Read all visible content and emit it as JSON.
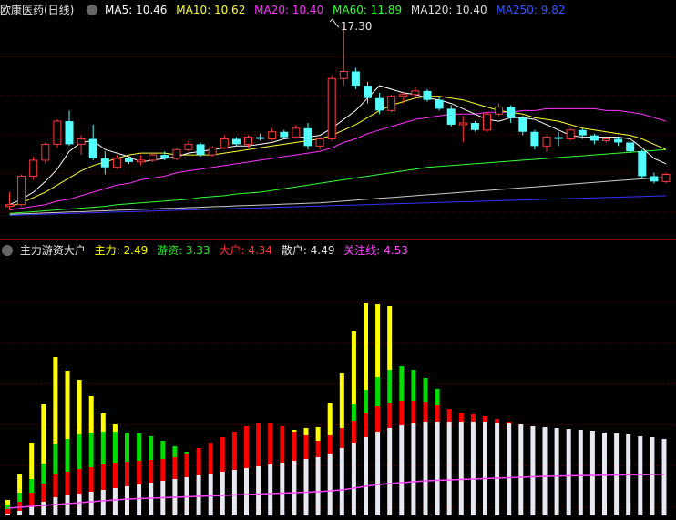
{
  "top_header": {
    "title": "欧康医药(日线)",
    "ma5": "MA5: 10.46",
    "ma10": "MA10: 10.62",
    "ma20": "MA20: 10.40",
    "ma60": "MA60: 11.89",
    "ma120": "MA120: 10.40",
    "ma250": "MA250: 9.82",
    "peak_label": "17.30"
  },
  "bottom_header": {
    "title": "主力游资大户",
    "zhuli": "主力: 2.49",
    "youzi": "游资: 3.33",
    "dahu": "大户: 4.34",
    "sanhu": "散户: 4.49",
    "guanzhu": "关注线: 4.53"
  },
  "colors": {
    "up": "#ff3b3b",
    "down": "#54ffff",
    "ma5": "#ffffff",
    "ma10": "#ffff33",
    "ma20": "#ff33ff",
    "ma60": "#33ff33",
    "ma120": "#cccccc",
    "ma250": "#3333ff",
    "zhuli": "#ffff00",
    "youzi": "#00dd00",
    "dahu": "#ff0000",
    "sanhu": "#e8e8f0",
    "guanzhu": "#ff40ff"
  },
  "chart_data": [
    {
      "type": "candlestick",
      "ylim": [
        6,
        17.8
      ],
      "candles": [
        [
          7.2,
          8.0,
          7.0,
          7.3
        ],
        [
          7.3,
          9.0,
          7.2,
          8.9
        ],
        [
          8.9,
          10.0,
          8.7,
          9.8
        ],
        [
          9.8,
          10.8,
          9.6,
          10.7
        ],
        [
          10.7,
          12.1,
          10.5,
          12.0
        ],
        [
          12.0,
          12.6,
          10.6,
          10.7
        ],
        [
          10.7,
          11.2,
          10.1,
          11.0
        ],
        [
          11.0,
          11.8,
          9.8,
          9.9
        ],
        [
          9.9,
          10.3,
          9.0,
          9.4
        ],
        [
          9.4,
          10.1,
          9.3,
          9.9
        ],
        [
          9.9,
          10.0,
          9.6,
          9.7
        ],
        [
          9.7,
          10.1,
          9.5,
          9.8
        ],
        [
          9.8,
          10.2,
          9.7,
          10.1
        ],
        [
          10.1,
          10.3,
          9.8,
          9.9
        ],
        [
          9.9,
          10.5,
          9.8,
          10.4
        ],
        [
          10.4,
          10.9,
          10.3,
          10.7
        ],
        [
          10.7,
          10.8,
          10.0,
          10.1
        ],
        [
          10.1,
          10.6,
          10.0,
          10.5
        ],
        [
          10.5,
          11.2,
          10.4,
          11.0
        ],
        [
          11.0,
          11.1,
          10.6,
          10.7
        ],
        [
          10.7,
          11.2,
          10.5,
          11.1
        ],
        [
          11.1,
          11.3,
          10.9,
          11.0
        ],
        [
          11.0,
          11.6,
          10.9,
          11.4
        ],
        [
          11.4,
          11.5,
          11.0,
          11.1
        ],
        [
          11.1,
          11.8,
          11.0,
          11.6
        ],
        [
          11.6,
          11.9,
          10.4,
          10.6
        ],
        [
          10.6,
          11.1,
          10.4,
          11.0
        ],
        [
          11.0,
          14.6,
          10.9,
          14.4
        ],
        [
          14.4,
          17.3,
          14.0,
          14.8
        ],
        [
          14.8,
          15.0,
          13.8,
          14.0
        ],
        [
          14.0,
          14.2,
          13.0,
          13.3
        ],
        [
          13.3,
          13.6,
          12.4,
          12.6
        ],
        [
          12.6,
          13.5,
          12.5,
          13.4
        ],
        [
          13.4,
          13.6,
          13.0,
          13.5
        ],
        [
          13.5,
          13.9,
          13.3,
          13.7
        ],
        [
          13.7,
          13.8,
          13.1,
          13.2
        ],
        [
          13.2,
          13.4,
          12.6,
          12.7
        ],
        [
          12.7,
          12.9,
          11.7,
          11.8
        ],
        [
          11.8,
          12.3,
          10.8,
          11.9
        ],
        [
          11.9,
          12.0,
          11.4,
          11.5
        ],
        [
          11.5,
          12.5,
          11.4,
          12.4
        ],
        [
          12.4,
          13.0,
          12.3,
          12.8
        ],
        [
          12.8,
          12.9,
          11.9,
          12.2
        ],
        [
          12.2,
          12.3,
          11.2,
          11.4
        ],
        [
          11.4,
          11.5,
          10.4,
          10.6
        ],
        [
          10.6,
          11.2,
          10.3,
          11.1
        ],
        [
          11.1,
          11.4,
          10.6,
          11.0
        ],
        [
          11.0,
          11.6,
          10.9,
          11.5
        ],
        [
          11.5,
          11.6,
          11.0,
          11.2
        ],
        [
          11.2,
          11.3,
          10.7,
          10.9
        ],
        [
          10.9,
          11.1,
          10.8,
          11.0
        ],
        [
          11.0,
          11.1,
          10.6,
          10.8
        ],
        [
          10.8,
          10.9,
          10.2,
          10.3
        ],
        [
          10.3,
          10.4,
          8.8,
          8.9
        ],
        [
          8.9,
          9.1,
          8.5,
          8.6
        ],
        [
          8.6,
          9.1,
          8.5,
          9.0
        ]
      ],
      "ma5": [
        7.3,
        7.6,
        8.0,
        8.6,
        9.3,
        10.3,
        10.8,
        10.9,
        10.4,
        10.2,
        10.0,
        9.7,
        9.8,
        9.9,
        10.0,
        10.2,
        10.3,
        10.4,
        10.5,
        10.6,
        10.6,
        10.7,
        10.8,
        11.0,
        11.1,
        11.1,
        11.2,
        11.6,
        12.1,
        12.6,
        13.3,
        14.0,
        13.8,
        13.6,
        13.5,
        13.3,
        13.2,
        13.0,
        12.7,
        12.4,
        12.1,
        12.0,
        12.2,
        12.2,
        12.1,
        11.8,
        11.5,
        11.2,
        11.1,
        11.1,
        11.1,
        11.1,
        11.0,
        10.5,
        9.9,
        9.6
      ],
      "ma10": [
        7.2,
        7.4,
        7.7,
        8.0,
        8.4,
        8.8,
        9.2,
        9.5,
        9.7,
        9.9,
        10.1,
        10.2,
        10.2,
        10.2,
        10.1,
        10.1,
        10.1,
        10.1,
        10.2,
        10.3,
        10.4,
        10.5,
        10.6,
        10.7,
        10.8,
        10.9,
        11.0,
        11.2,
        11.5,
        11.8,
        12.2,
        12.6,
        12.9,
        13.1,
        13.3,
        13.4,
        13.4,
        13.3,
        13.2,
        13.0,
        12.8,
        12.6,
        12.5,
        12.4,
        12.2,
        12.1,
        12.0,
        11.8,
        11.6,
        11.5,
        11.4,
        11.3,
        11.2,
        11.0,
        10.7,
        10.4
      ],
      "ma20": [
        7.0,
        7.1,
        7.2,
        7.3,
        7.5,
        7.6,
        7.8,
        8.0,
        8.2,
        8.4,
        8.5,
        8.7,
        8.8,
        8.9,
        9.1,
        9.2,
        9.3,
        9.4,
        9.5,
        9.6,
        9.7,
        9.8,
        9.9,
        10.0,
        10.1,
        10.2,
        10.3,
        10.5,
        10.8,
        11.0,
        11.3,
        11.5,
        11.7,
        11.9,
        12.1,
        12.2,
        12.3,
        12.4,
        12.4,
        12.4,
        12.5,
        12.5,
        12.5,
        12.6,
        12.6,
        12.7,
        12.7,
        12.7,
        12.7,
        12.7,
        12.6,
        12.6,
        12.5,
        12.4,
        12.2,
        12.0
      ],
      "ma60": [
        6.8,
        6.85,
        6.9,
        6.95,
        7.0,
        7.05,
        7.1,
        7.15,
        7.2,
        7.3,
        7.35,
        7.4,
        7.45,
        7.5,
        7.55,
        7.6,
        7.7,
        7.75,
        7.8,
        7.9,
        7.95,
        8.0,
        8.1,
        8.2,
        8.3,
        8.4,
        8.5,
        8.6,
        8.7,
        8.8,
        8.9,
        9.0,
        9.1,
        9.2,
        9.3,
        9.4,
        9.45,
        9.5,
        9.55,
        9.6,
        9.65,
        9.7,
        9.75,
        9.8,
        9.85,
        9.9,
        9.95,
        10.0,
        10.05,
        10.1,
        10.15,
        10.2,
        10.25,
        10.3,
        10.35,
        10.4
      ],
      "ma120": [
        6.75,
        6.78,
        6.8,
        6.83,
        6.85,
        6.88,
        6.9,
        6.93,
        6.95,
        6.98,
        7.0,
        7.03,
        7.05,
        7.08,
        7.1,
        7.13,
        7.15,
        7.18,
        7.2,
        7.23,
        7.25,
        7.28,
        7.3,
        7.33,
        7.35,
        7.38,
        7.4,
        7.45,
        7.5,
        7.55,
        7.6,
        7.65,
        7.7,
        7.75,
        7.8,
        7.85,
        7.9,
        7.95,
        8.0,
        8.05,
        8.1,
        8.15,
        8.2,
        8.25,
        8.3,
        8.35,
        8.4,
        8.45,
        8.5,
        8.55,
        8.6,
        8.65,
        8.7,
        8.75,
        8.8,
        8.82
      ],
      "ma250": [
        6.7,
        6.72,
        6.74,
        6.76,
        6.78,
        6.8,
        6.82,
        6.84,
        6.86,
        6.88,
        6.9,
        6.92,
        6.94,
        6.96,
        6.98,
        7.0,
        7.02,
        7.04,
        7.06,
        7.08,
        7.1,
        7.12,
        7.14,
        7.16,
        7.18,
        7.2,
        7.22,
        7.24,
        7.26,
        7.28,
        7.3,
        7.32,
        7.34,
        7.36,
        7.38,
        7.4,
        7.42,
        7.44,
        7.46,
        7.48,
        7.5,
        7.52,
        7.54,
        7.56,
        7.58,
        7.6,
        7.62,
        7.64,
        7.66,
        7.68,
        7.7,
        7.72,
        7.74,
        7.76,
        7.78,
        7.8
      ]
    },
    {
      "type": "stacked-bar",
      "ylim": [
        0,
        28
      ],
      "sanhu": [
        0.2,
        0.5,
        1.0,
        1.5,
        2.0,
        2.2,
        2.4,
        2.6,
        2.8,
        3.0,
        3.2,
        3.4,
        3.6,
        3.8,
        4.0,
        4.2,
        4.4,
        4.6,
        4.8,
        5.0,
        5.2,
        5.4,
        5.6,
        5.8,
        6.0,
        6.2,
        6.4,
        6.8,
        7.4,
        8.0,
        8.6,
        9.2,
        9.6,
        9.9,
        10.1,
        10.3,
        10.3,
        10.3,
        10.3,
        10.3,
        10.3,
        10.2,
        10.1,
        10.0,
        9.8,
        9.7,
        9.6,
        9.5,
        9.4,
        9.3,
        9.1,
        9.0,
        8.9,
        8.7,
        8.6,
        8.4
      ],
      "dahu": [
        0.5,
        1.0,
        1.5,
        2.0,
        2.5,
        2.6,
        2.7,
        2.7,
        2.8,
        2.8,
        2.7,
        2.6,
        2.5,
        2.4,
        2.4,
        2.6,
        3.0,
        3.4,
        3.8,
        4.2,
        4.6,
        4.8,
        4.6,
        4.0,
        3.2,
        2.6,
        1.8,
        2.0,
        2.2,
        2.4,
        2.6,
        2.8,
        2.8,
        2.7,
        2.5,
        2.2,
        1.8,
        1.4,
        1.0,
        0.8,
        0.6,
        0.4,
        0.2,
        0,
        0,
        0,
        0,
        0,
        0,
        0,
        0,
        0,
        0,
        0,
        0,
        0
      ],
      "youzi": [
        0.5,
        1.0,
        1.5,
        2.2,
        3.4,
        3.6,
        3.8,
        3.8,
        3.6,
        3.4,
        3.2,
        3.0,
        2.6,
        2.0,
        1.2,
        0.2,
        0,
        0,
        0,
        0,
        0,
        0,
        0,
        0,
        0,
        0,
        0,
        0,
        0,
        1.8,
        2.6,
        3.2,
        3.6,
        3.8,
        3.4,
        2.6,
        1.8,
        0,
        0,
        0,
        0,
        0,
        0,
        0,
        0,
        0,
        0,
        0,
        0,
        0,
        0,
        0,
        0,
        0,
        0,
        0
      ],
      "zhuli": [
        0.5,
        2.0,
        4.0,
        6.5,
        9.5,
        7.5,
        6.0,
        4.0,
        2.0,
        0.8,
        0,
        0,
        0,
        0,
        0,
        0,
        0,
        0,
        0,
        0,
        0,
        0,
        0,
        0,
        0.2,
        0.8,
        1.5,
        3.5,
        6.0,
        8.0,
        9.5,
        8.0,
        7.0,
        0,
        0,
        0,
        0,
        0,
        0,
        0,
        0,
        0,
        0,
        0,
        0,
        0,
        0,
        0,
        0,
        0,
        0,
        0,
        0,
        0,
        0,
        0
      ],
      "guanzhu": [
        0.8,
        0.9,
        1.0,
        1.1,
        1.2,
        1.3,
        1.4,
        1.5,
        1.6,
        1.7,
        1.8,
        1.85,
        1.9,
        1.95,
        2.0,
        2.05,
        2.1,
        2.15,
        2.2,
        2.25,
        2.3,
        2.35,
        2.4,
        2.45,
        2.5,
        2.55,
        2.6,
        2.7,
        2.8,
        3.0,
        3.2,
        3.4,
        3.5,
        3.6,
        3.7,
        3.8,
        3.85,
        3.9,
        3.95,
        4.0,
        4.05,
        4.1,
        4.15,
        4.2,
        4.25,
        4.3,
        4.32,
        4.35,
        4.38,
        4.4,
        4.42,
        4.44,
        4.46,
        4.48,
        4.5,
        4.53
      ]
    }
  ]
}
